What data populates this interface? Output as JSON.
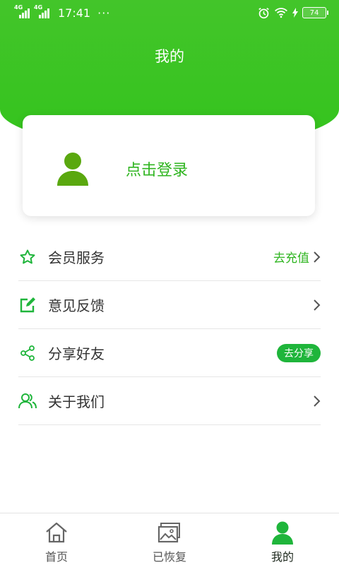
{
  "status_bar": {
    "network1": "4G",
    "network2": "4G",
    "time": "17:41",
    "dots": "···",
    "battery": "74"
  },
  "header": {
    "title": "我的"
  },
  "login_card": {
    "label": "点击登录"
  },
  "menu": [
    {
      "label": "会员服务",
      "action": "去充值",
      "icon": "star-icon"
    },
    {
      "label": "意见反馈",
      "icon": "edit-icon"
    },
    {
      "label": "分享好友",
      "action": "去分享",
      "icon": "share-icon"
    },
    {
      "label": "关于我们",
      "icon": "users-icon"
    }
  ],
  "bottom_nav": [
    {
      "label": "首页",
      "icon": "home-icon"
    },
    {
      "label": "已恢复",
      "icon": "gallery-icon"
    },
    {
      "label": "我的",
      "icon": "person-icon",
      "active": true
    }
  ],
  "colors": {
    "primary": "#34c41d",
    "accent_green": "#2fb520",
    "pill": "#1fb53b"
  }
}
